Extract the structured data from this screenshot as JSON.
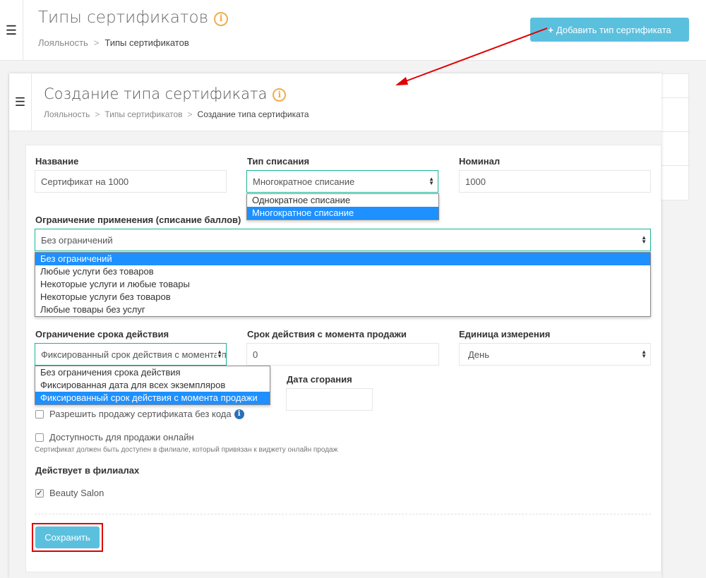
{
  "back": {
    "title": "Типы сертификатов",
    "info": "i",
    "breadcrumb": [
      "Лояльность",
      "Типы сертификатов"
    ],
    "separator": ">",
    "add_button_label": "Добавить тип сертификата"
  },
  "modal": {
    "title": "Создание типа сертификата",
    "info": "i",
    "breadcrumb": [
      "Лояльность",
      "Типы сертификатов",
      "Создание типа сертификата"
    ],
    "separator": ">"
  },
  "form": {
    "name": {
      "label": "Название",
      "value": "Сертификат на 1000"
    },
    "writeoff": {
      "label": "Тип списания",
      "value": "Многократное списание",
      "options": [
        "Однократное списание",
        "Многократное списание"
      ]
    },
    "nominal": {
      "label": "Номинал",
      "value": "1000"
    },
    "restriction": {
      "label": "Ограничение применения (списание баллов)",
      "value": "Без ограничений",
      "options": [
        "Без ограничений",
        "Любые услуги без товаров",
        "Некоторые услуги и любые товары",
        "Некоторые услуги без товаров",
        "Любые товары без услуг"
      ]
    },
    "term_limit": {
      "label": "Ограничение срока действия",
      "value": "Фиксированный срок действия с момента продажи",
      "options": [
        "Без ограничения срока действия",
        "Фиксированная дата для всех экземпляров",
        "Фиксированный срок действия с момента продажи"
      ]
    },
    "term_from_sale": {
      "label": "Срок действия с момента продажи",
      "value": "0"
    },
    "unit": {
      "label": "Единица измерения",
      "value": "День"
    },
    "burn_date": {
      "label": "Дата сгорания",
      "value": ""
    },
    "allow_without_code": {
      "label": "Разрешить продажу сертификата без кода",
      "info": "i",
      "checked": false
    },
    "online": {
      "label": "Доступность для продажи онлайн",
      "checked": false,
      "hint": "Сертификат должен быть доступен в филиале, который привязан к виджету онлайн продаж"
    },
    "branches": {
      "label": "Действует в филиалах",
      "items": [
        {
          "name": "Beauty Salon",
          "checked": true
        }
      ]
    },
    "save_label": "Сохранить"
  },
  "colors": {
    "accent": "#5bc0de",
    "focus": "#1ab394",
    "selection": "#1e90ff",
    "highlight": "#e00000",
    "info": "#f0ad4e"
  }
}
